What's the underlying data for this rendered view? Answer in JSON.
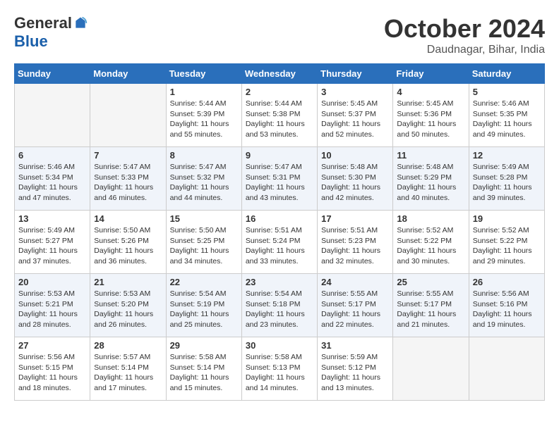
{
  "logo": {
    "general": "General",
    "blue": "Blue"
  },
  "title": "October 2024",
  "location": "Daudnagar, Bihar, India",
  "days_of_week": [
    "Sunday",
    "Monday",
    "Tuesday",
    "Wednesday",
    "Thursday",
    "Friday",
    "Saturday"
  ],
  "weeks": [
    [
      {
        "day": "",
        "content": ""
      },
      {
        "day": "",
        "content": ""
      },
      {
        "day": "1",
        "content": "Sunrise: 5:44 AM\nSunset: 5:39 PM\nDaylight: 11 hours and 55 minutes."
      },
      {
        "day": "2",
        "content": "Sunrise: 5:44 AM\nSunset: 5:38 PM\nDaylight: 11 hours and 53 minutes."
      },
      {
        "day": "3",
        "content": "Sunrise: 5:45 AM\nSunset: 5:37 PM\nDaylight: 11 hours and 52 minutes."
      },
      {
        "day": "4",
        "content": "Sunrise: 5:45 AM\nSunset: 5:36 PM\nDaylight: 11 hours and 50 minutes."
      },
      {
        "day": "5",
        "content": "Sunrise: 5:46 AM\nSunset: 5:35 PM\nDaylight: 11 hours and 49 minutes."
      }
    ],
    [
      {
        "day": "6",
        "content": "Sunrise: 5:46 AM\nSunset: 5:34 PM\nDaylight: 11 hours and 47 minutes."
      },
      {
        "day": "7",
        "content": "Sunrise: 5:47 AM\nSunset: 5:33 PM\nDaylight: 11 hours and 46 minutes."
      },
      {
        "day": "8",
        "content": "Sunrise: 5:47 AM\nSunset: 5:32 PM\nDaylight: 11 hours and 44 minutes."
      },
      {
        "day": "9",
        "content": "Sunrise: 5:47 AM\nSunset: 5:31 PM\nDaylight: 11 hours and 43 minutes."
      },
      {
        "day": "10",
        "content": "Sunrise: 5:48 AM\nSunset: 5:30 PM\nDaylight: 11 hours and 42 minutes."
      },
      {
        "day": "11",
        "content": "Sunrise: 5:48 AM\nSunset: 5:29 PM\nDaylight: 11 hours and 40 minutes."
      },
      {
        "day": "12",
        "content": "Sunrise: 5:49 AM\nSunset: 5:28 PM\nDaylight: 11 hours and 39 minutes."
      }
    ],
    [
      {
        "day": "13",
        "content": "Sunrise: 5:49 AM\nSunset: 5:27 PM\nDaylight: 11 hours and 37 minutes."
      },
      {
        "day": "14",
        "content": "Sunrise: 5:50 AM\nSunset: 5:26 PM\nDaylight: 11 hours and 36 minutes."
      },
      {
        "day": "15",
        "content": "Sunrise: 5:50 AM\nSunset: 5:25 PM\nDaylight: 11 hours and 34 minutes."
      },
      {
        "day": "16",
        "content": "Sunrise: 5:51 AM\nSunset: 5:24 PM\nDaylight: 11 hours and 33 minutes."
      },
      {
        "day": "17",
        "content": "Sunrise: 5:51 AM\nSunset: 5:23 PM\nDaylight: 11 hours and 32 minutes."
      },
      {
        "day": "18",
        "content": "Sunrise: 5:52 AM\nSunset: 5:22 PM\nDaylight: 11 hours and 30 minutes."
      },
      {
        "day": "19",
        "content": "Sunrise: 5:52 AM\nSunset: 5:22 PM\nDaylight: 11 hours and 29 minutes."
      }
    ],
    [
      {
        "day": "20",
        "content": "Sunrise: 5:53 AM\nSunset: 5:21 PM\nDaylight: 11 hours and 28 minutes."
      },
      {
        "day": "21",
        "content": "Sunrise: 5:53 AM\nSunset: 5:20 PM\nDaylight: 11 hours and 26 minutes."
      },
      {
        "day": "22",
        "content": "Sunrise: 5:54 AM\nSunset: 5:19 PM\nDaylight: 11 hours and 25 minutes."
      },
      {
        "day": "23",
        "content": "Sunrise: 5:54 AM\nSunset: 5:18 PM\nDaylight: 11 hours and 23 minutes."
      },
      {
        "day": "24",
        "content": "Sunrise: 5:55 AM\nSunset: 5:17 PM\nDaylight: 11 hours and 22 minutes."
      },
      {
        "day": "25",
        "content": "Sunrise: 5:55 AM\nSunset: 5:17 PM\nDaylight: 11 hours and 21 minutes."
      },
      {
        "day": "26",
        "content": "Sunrise: 5:56 AM\nSunset: 5:16 PM\nDaylight: 11 hours and 19 minutes."
      }
    ],
    [
      {
        "day": "27",
        "content": "Sunrise: 5:56 AM\nSunset: 5:15 PM\nDaylight: 11 hours and 18 minutes."
      },
      {
        "day": "28",
        "content": "Sunrise: 5:57 AM\nSunset: 5:14 PM\nDaylight: 11 hours and 17 minutes."
      },
      {
        "day": "29",
        "content": "Sunrise: 5:58 AM\nSunset: 5:14 PM\nDaylight: 11 hours and 15 minutes."
      },
      {
        "day": "30",
        "content": "Sunrise: 5:58 AM\nSunset: 5:13 PM\nDaylight: 11 hours and 14 minutes."
      },
      {
        "day": "31",
        "content": "Sunrise: 5:59 AM\nSunset: 5:12 PM\nDaylight: 11 hours and 13 minutes."
      },
      {
        "day": "",
        "content": ""
      },
      {
        "day": "",
        "content": ""
      }
    ]
  ]
}
